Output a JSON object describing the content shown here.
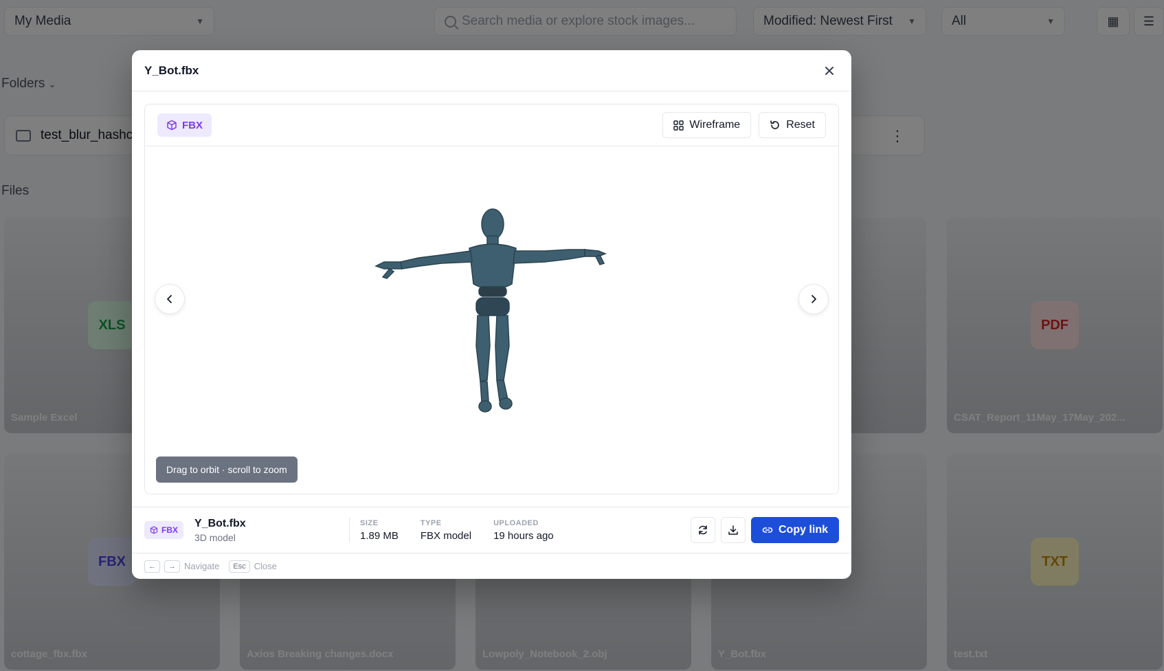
{
  "background": {
    "media_select": "My Media",
    "search_placeholder": "Search media or explore stock images...",
    "sort_select": "Modified: Newest First",
    "filter_select": "All",
    "folders_heading": "Folders",
    "folder_name": "test_blur_hashcode",
    "files_heading": "Files",
    "cards": [
      {
        "name": "Sample Excel",
        "badge": "XLS"
      },
      {
        "name": "CSAT_Report_11May_17May_202...",
        "badge": "PDF"
      },
      {
        "name": "cottage_fbx.fbx",
        "badge": "FBX"
      },
      {
        "name": "Axios Breaking changes.docx",
        "badge": ""
      },
      {
        "name": "Lowpoly_Notebook_2.obj",
        "badge": ""
      },
      {
        "name": "Y_Bot.fbx",
        "badge": ""
      },
      {
        "name": "test.txt",
        "badge": "TXT"
      }
    ]
  },
  "modal": {
    "title": "Y_Bot.fbx",
    "format_chip": "FBX",
    "wireframe_label": "Wireframe",
    "reset_label": "Reset",
    "hint": "Drag to orbit · scroll to zoom",
    "info": {
      "chip": "FBX",
      "filename": "Y_Bot.fbx",
      "subtitle": "3D model",
      "size_label": "SIZE",
      "size_value": "1.89 MB",
      "type_label": "TYPE",
      "type_value": "FBX model",
      "uploaded_label": "UPLOADED",
      "uploaded_value": "19 hours ago",
      "copy_link_label": "Copy link"
    },
    "footer": {
      "left_key": "←",
      "right_key": "→",
      "navigate_label": "Navigate",
      "esc_key": "Esc",
      "close_label": "Close"
    }
  },
  "colors": {
    "accent": "#1d4ed8",
    "format_chip": "#7c3aed",
    "model": "#3e5f6f"
  }
}
